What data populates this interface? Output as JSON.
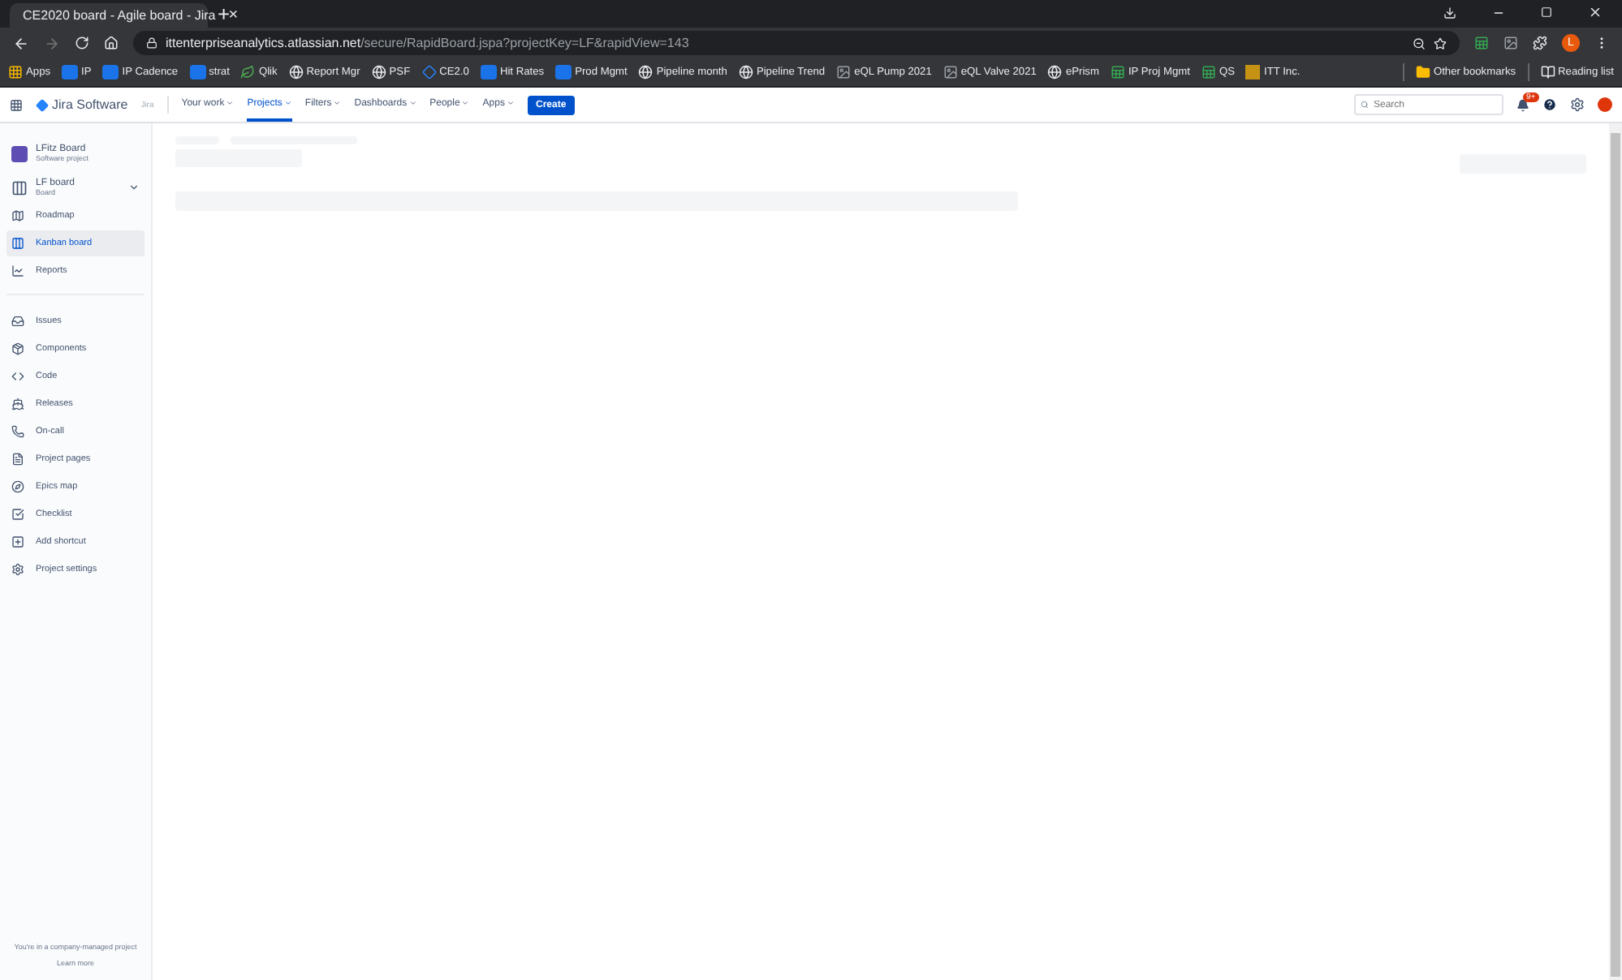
{
  "browser": {
    "tab": {
      "title": "CE2020 board - Agile board - Jira",
      "close": "×"
    },
    "new_tab": "+",
    "url_host": "ittenterpriseanalytics.atlassian.net",
    "url_path": "/secure/RapidBoard.jspa?projectKey=LF&rapidView=143",
    "profile": "L",
    "bookmarks": [
      {
        "kind": "apps",
        "label": "Apps"
      },
      {
        "kind": "s",
        "label": "IP"
      },
      {
        "kind": "s",
        "label": "IP Cadence"
      },
      {
        "kind": "s",
        "label": "strat"
      },
      {
        "kind": "leaf",
        "label": "Qlik"
      },
      {
        "kind": "globe",
        "label": "Report Mgr"
      },
      {
        "kind": "globe",
        "label": "PSF"
      },
      {
        "kind": "diamond",
        "label": "CE2.0"
      },
      {
        "kind": "s",
        "label": "Hit Rates"
      },
      {
        "kind": "s",
        "label": "Prod Mgmt"
      },
      {
        "kind": "globe",
        "label": "Pipeline month"
      },
      {
        "kind": "globe",
        "label": "Pipeline Trend"
      },
      {
        "kind": "image",
        "label": "eQL Pump 2021"
      },
      {
        "kind": "image",
        "label": "eQL Valve 2021"
      },
      {
        "kind": "globe",
        "label": "ePrism"
      },
      {
        "kind": "sheet",
        "label": "IP Proj Mgmt"
      },
      {
        "kind": "sheet",
        "label": "QS"
      },
      {
        "kind": "logo",
        "label": "ITT Inc."
      }
    ],
    "other_bookmarks": "Other bookmarks",
    "reading_list": "Reading list"
  },
  "jira": {
    "product": "Jira Software",
    "home": "Jira",
    "nav": [
      {
        "label": "Your work",
        "selected": false
      },
      {
        "label": "Projects",
        "selected": true
      },
      {
        "label": "Filters",
        "selected": false
      },
      {
        "label": "Dashboards",
        "selected": false
      },
      {
        "label": "People",
        "selected": false
      },
      {
        "label": "Apps",
        "selected": false
      }
    ],
    "create": "Create",
    "search": {
      "placeholder": "Search"
    },
    "notifications": "9+"
  },
  "sidebar": {
    "project": {
      "name": "LFitz Board",
      "type": "Software project"
    },
    "board": {
      "name": "LF board",
      "type": "Board"
    },
    "groups": [
      [
        {
          "kind": "roadmap",
          "label": "Roadmap",
          "selected": false
        },
        {
          "kind": "kanban",
          "label": "Kanban board",
          "selected": true
        },
        {
          "kind": "chart",
          "label": "Reports",
          "selected": false
        }
      ],
      [
        {
          "kind": "issues",
          "label": "Issues",
          "selected": false
        },
        {
          "kind": "box",
          "label": "Components",
          "selected": false
        },
        {
          "kind": "code",
          "label": "Code",
          "selected": false
        },
        {
          "kind": "ship",
          "label": "Releases",
          "selected": false
        },
        {
          "kind": "phone",
          "label": "On-call",
          "selected": false
        },
        {
          "kind": "page",
          "label": "Project pages",
          "selected": false
        },
        {
          "kind": "map",
          "label": "Epics map",
          "selected": false
        },
        {
          "kind": "check",
          "label": "Checklist",
          "selected": false
        },
        {
          "kind": "add",
          "label": "Add shortcut",
          "selected": false
        },
        {
          "kind": "gear",
          "label": "Project settings",
          "selected": false
        }
      ]
    ],
    "footer": "You're in a company-managed project",
    "learn_more": "Learn more"
  }
}
